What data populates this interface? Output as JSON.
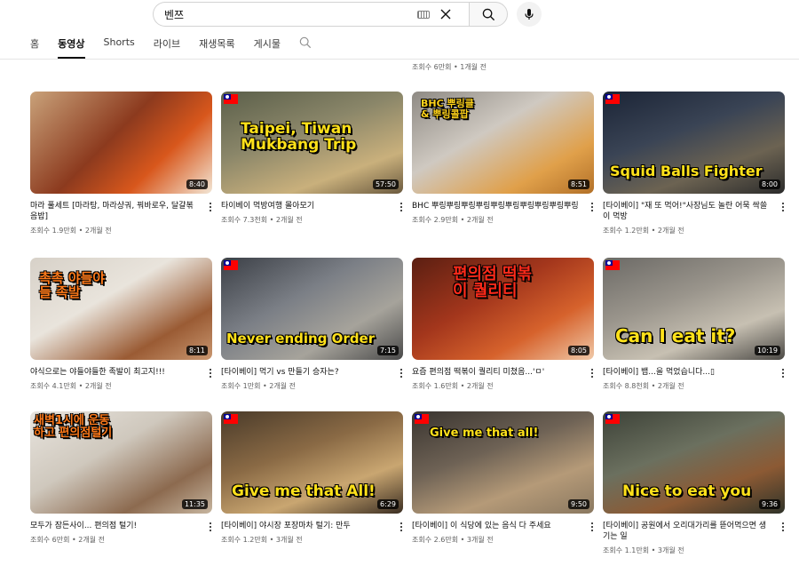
{
  "search": {
    "query": "벤쯔"
  },
  "tabs": [
    {
      "label": "홈",
      "active": false
    },
    {
      "label": "동영상",
      "active": true
    },
    {
      "label": "Shorts",
      "active": false
    },
    {
      "label": "라이브",
      "active": false
    },
    {
      "label": "재생목록",
      "active": false
    },
    {
      "label": "게시물",
      "active": false
    }
  ],
  "prev_meta": "조회수 6만회 • 1개월 전",
  "videos": [
    {
      "title": "마라 풀세트 [마라탕, 마라샹궈, 꿔바로우, 달걀볶음밥]",
      "meta": "조회수 1.9만회 • 2개월 전",
      "duration": "8:40",
      "flag": false,
      "overlay": "",
      "thumb_bg": "linear-gradient(135deg,#c9a27a 0%,#8c3a1e 45%,#d8571c 70%,#f2e6d5 100%)",
      "overlay_color": "#ff3b1f"
    },
    {
      "title": "타이베이 먹방여행 몰아모기",
      "meta": "조회수 7.3천회 • 2개월 전",
      "duration": "57:50",
      "flag": true,
      "overlay": "Taipei, Tiwan Mukbang Trip",
      "thumb_bg": "linear-gradient(160deg,#5b5f4a 0%,#8a8669 40%,#c9b07c 75%,#6b5a3f 100%)",
      "overlay_color": "#ffe11a"
    },
    {
      "title": "BHC 뿌링뿌링뿌링뿌링뿌링뿌링뿌링뿌링뿌링뿌링",
      "meta": "조회수 2.9만회 • 2개월 전",
      "duration": "8:51",
      "flag": false,
      "overlay": "BHC 뿌링클& 뿌링콜팝",
      "thumb_bg": "linear-gradient(150deg,#8e8a84 0%,#cfc9c1 40%,#e0a04a 75%,#b27028 100%)",
      "overlay_color": "#ffd21a"
    },
    {
      "title": "[타이베이] \"재 또 먹어!\"사장님도 놀란 어묵 싹쓸이 먹방",
      "meta": "조회수 1.2만회 • 2개월 전",
      "duration": "8:00",
      "flag": true,
      "overlay": "Squid Balls Fighter",
      "thumb_bg": "linear-gradient(160deg,#1b2436 0%,#3a4455 40%,#6c6352 70%,#2b2b2b 100%)",
      "overlay_color": "#ffe11a"
    },
    {
      "title": "야식으로는 야들야들한 족발이 최고지!!!",
      "meta": "조회수 4.1만회 • 2개월 전",
      "duration": "8:11",
      "flag": false,
      "overlay": "촉촉 야들야들 족발",
      "thumb_bg": "linear-gradient(150deg,#d7d1c8 0%,#e9e4dc 40%,#9a5b34 75%,#c99770 100%)",
      "overlay_color": "#ff7a1a"
    },
    {
      "title": "[타이베이] 먹기 vs 만들기 승자는?",
      "meta": "조회수 1만회 • 2개월 전",
      "duration": "7:15",
      "flag": true,
      "overlay": "Never ending Order",
      "thumb_bg": "linear-gradient(150deg,#3b3f46 0%,#7b7f86 40%,#a6a39b 70%,#4a4a4a 100%)",
      "overlay_color": "#ffe11a"
    },
    {
      "title": "요즘 편의점 떡볶이 퀄리티 미쳤음...'ㅁ'",
      "meta": "조회수 1.6만회 • 2개월 전",
      "duration": "8:05",
      "flag": false,
      "overlay": "편의점 떡볶이 퀄리티",
      "thumb_bg": "linear-gradient(150deg,#5b1f12 0%,#a3361c 40%,#d6622c 70%,#f0c9a8 100%)",
      "overlay_color": "#ff2a1a"
    },
    {
      "title": "[타이베이] 뱀...을 먹었습니다...▯",
      "meta": "조회수 8.8천회 • 2개월 전",
      "duration": "10:19",
      "flag": true,
      "overlay": "Can I eat it?",
      "thumb_bg": "linear-gradient(160deg,#6c6a66 0%,#9a958c 40%,#c7c0b2 70%,#4b4945 100%)",
      "overlay_color": "#ffe11a"
    },
    {
      "title": "모두가 잠든사이... 편의점 털기!",
      "meta": "조회수 6만회 • 2개월 전",
      "duration": "11:35",
      "flag": false,
      "overlay": "새벽1시에 운동하고 편의점털기",
      "thumb_bg": "linear-gradient(150deg,#e8e4de 0%,#cfc8bd 40%,#8c6a4f 75%,#c7b6a0 100%)",
      "overlay_color": "#ff7a1a"
    },
    {
      "title": "[타이베이] 야시장 포장마차 털기: 만두",
      "meta": "조회수 1.2만회 • 3개월 전",
      "duration": "6:29",
      "flag": true,
      "overlay": "Give me that All!",
      "thumb_bg": "linear-gradient(160deg,#4a3b2a 0%,#8a6a45 40%,#c9a671 70%,#3b2e22 100%)",
      "overlay_color": "#ffe11a"
    },
    {
      "title": "[타이베이] 이 식당에 있는 음식 다 주세요",
      "meta": "조회수 2.6만회 • 3개월 전",
      "duration": "9:50",
      "flag": true,
      "overlay": "Give me that all!",
      "thumb_bg": "linear-gradient(160deg,#3a3530 0%,#6e6255 40%,#b59a78 70%,#8a7860 100%)",
      "overlay_color": "#ffe11a"
    },
    {
      "title": "[타이베이] 공원에서 오리대가리를 뜯어먹으면 생기는 일",
      "meta": "조회수 1.1만회 • 3개월 전",
      "duration": "9:36",
      "flag": true,
      "overlay": "Nice to eat you",
      "thumb_bg": "linear-gradient(160deg,#3d4238 0%,#6b705f 40%,#8c5a34 70%,#2f3329 100%)",
      "overlay_color": "#ffe11a"
    }
  ]
}
